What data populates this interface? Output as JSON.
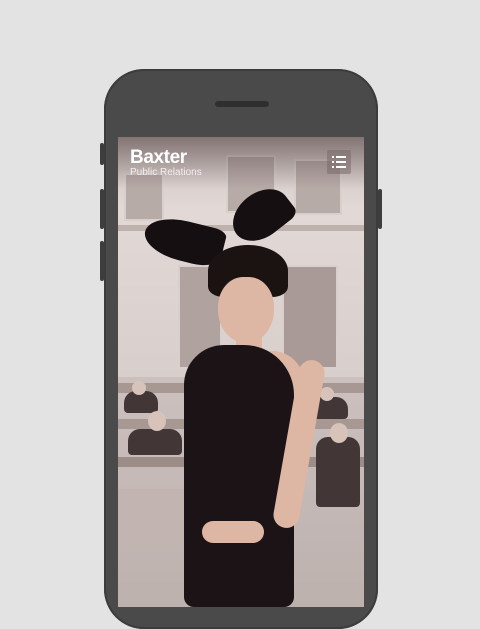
{
  "app": {
    "logo_title": "Baxter",
    "logo_subtitle": "Public Relations"
  },
  "header": {
    "menu_icon": "hamburger-menu-icon"
  },
  "colors": {
    "page_background": "#e3e3e3",
    "phone_frame": "#4a4a4a",
    "logo_text": "#ffffff"
  }
}
